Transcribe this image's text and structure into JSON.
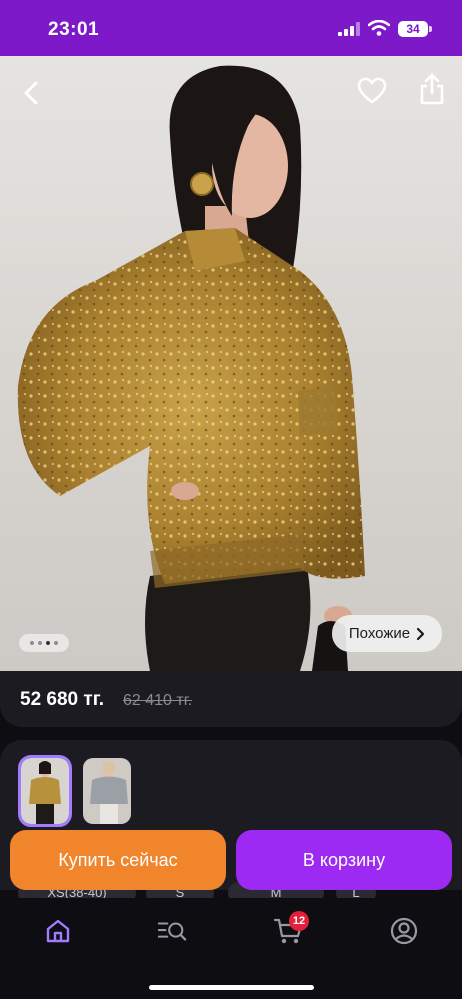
{
  "status_bar": {
    "time": "23:01",
    "battery": "34"
  },
  "product": {
    "price": "52 680 тг.",
    "old_price": "62 410 тг.",
    "similar_label": "Похожие",
    "image_pages": 4,
    "image_active_index": 2
  },
  "variants": {
    "count": 2,
    "selected_index": 0
  },
  "sizes_partial": [
    "XS(38-40)",
    "S",
    "M",
    "L"
  ],
  "actions": {
    "buy_now": "Купить сейчас",
    "add_to_cart": "В корзину"
  },
  "nav": {
    "cart_badge": "12",
    "active": "home"
  },
  "colors": {
    "status_bar": "#7d19c9",
    "buy_button": "#f0852c",
    "cart_button": "#9c2af3",
    "badge": "#e3203c",
    "nav_active": "#a37bff"
  },
  "icons": [
    "back-icon",
    "heart-icon",
    "share-icon",
    "chevron-right-icon",
    "home-icon",
    "catalog-search-icon",
    "cart-icon",
    "profile-icon"
  ]
}
